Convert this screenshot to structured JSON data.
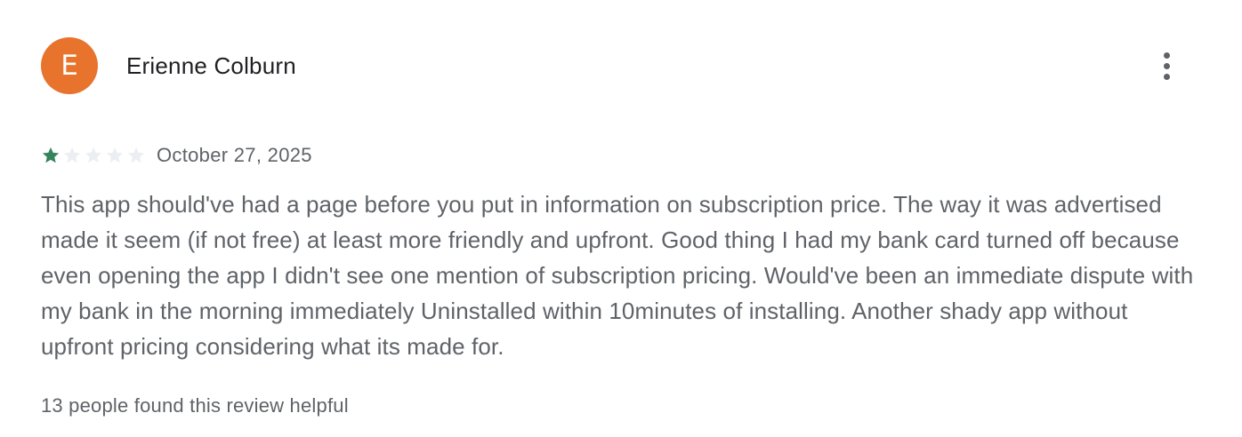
{
  "review": {
    "avatar_initial": "E",
    "avatar_color": "#e8732c",
    "reviewer_name": "Erienne Colburn",
    "more_icon": "more-vert-icon",
    "rating": 1,
    "rating_max": 5,
    "star_filled_color": "#34845c",
    "star_empty_color": "#eceff1",
    "date": "October 27, 2025",
    "body": "This app should've had a page before you put in information on subscription price. The way it was advertised made it seem (if not free) at least more friendly and upfront. Good thing I had my bank card turned off because even opening the app I didn't see one mention of subscription pricing. Would've been an immediate dispute with my bank in the morning immediately Uninstalled within 10minutes of installing. Another shady app without upfront pricing considering what its made for.",
    "helpful_text": "13 people found this review helpful"
  }
}
